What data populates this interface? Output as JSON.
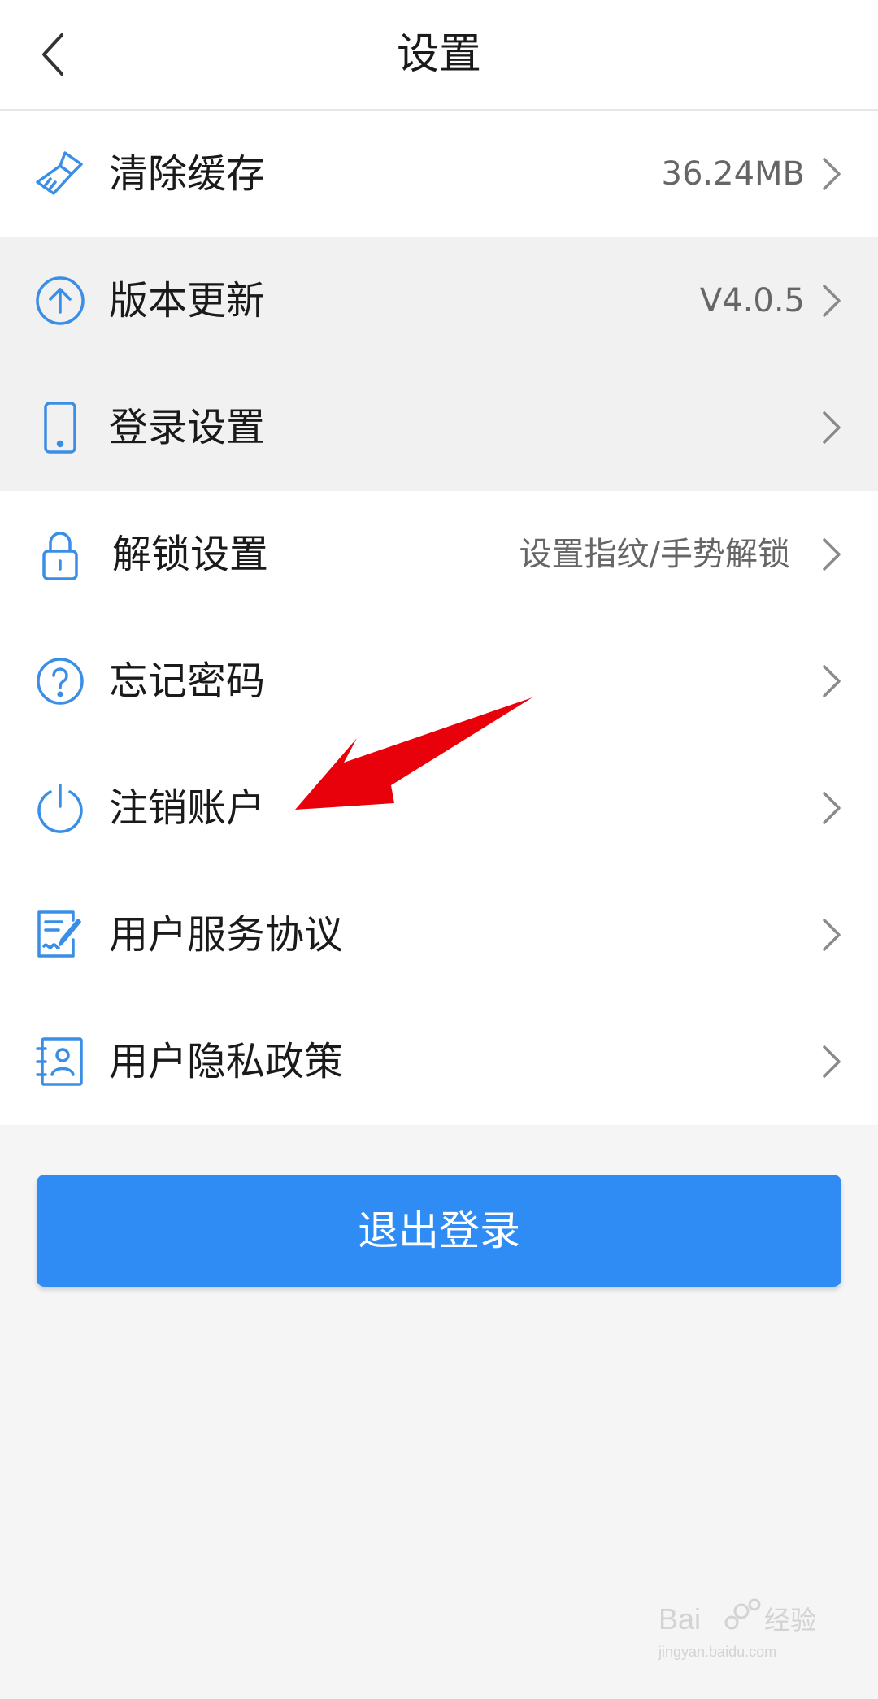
{
  "header": {
    "title": "设置"
  },
  "settings": [
    {
      "label": "清除缓存",
      "value": "36.24MB",
      "icon": "broom-icon"
    },
    {
      "label": "版本更新",
      "value": "V4.0.5",
      "icon": "upload-circle-icon"
    },
    {
      "label": "登录设置",
      "value": "",
      "icon": "phone-icon"
    },
    {
      "label": "解锁设置",
      "value": "设置指纹/手势解锁",
      "icon": "lock-icon"
    },
    {
      "label": "忘记密码",
      "value": "",
      "icon": "question-circle-icon"
    },
    {
      "label": "注销账户",
      "value": "",
      "icon": "power-icon"
    },
    {
      "label": "用户服务协议",
      "value": "",
      "icon": "document-sign-icon"
    },
    {
      "label": "用户隐私政策",
      "value": "",
      "icon": "contact-card-icon"
    }
  ],
  "logout": {
    "label": "退出登录"
  },
  "watermark": {
    "text_top": "Bai经验",
    "text_bottom": "jingyan.baidu.com"
  },
  "colors": {
    "accent": "#2f8cf4",
    "icon": "#3a8ee6",
    "annotation_arrow": "#e8000a"
  }
}
